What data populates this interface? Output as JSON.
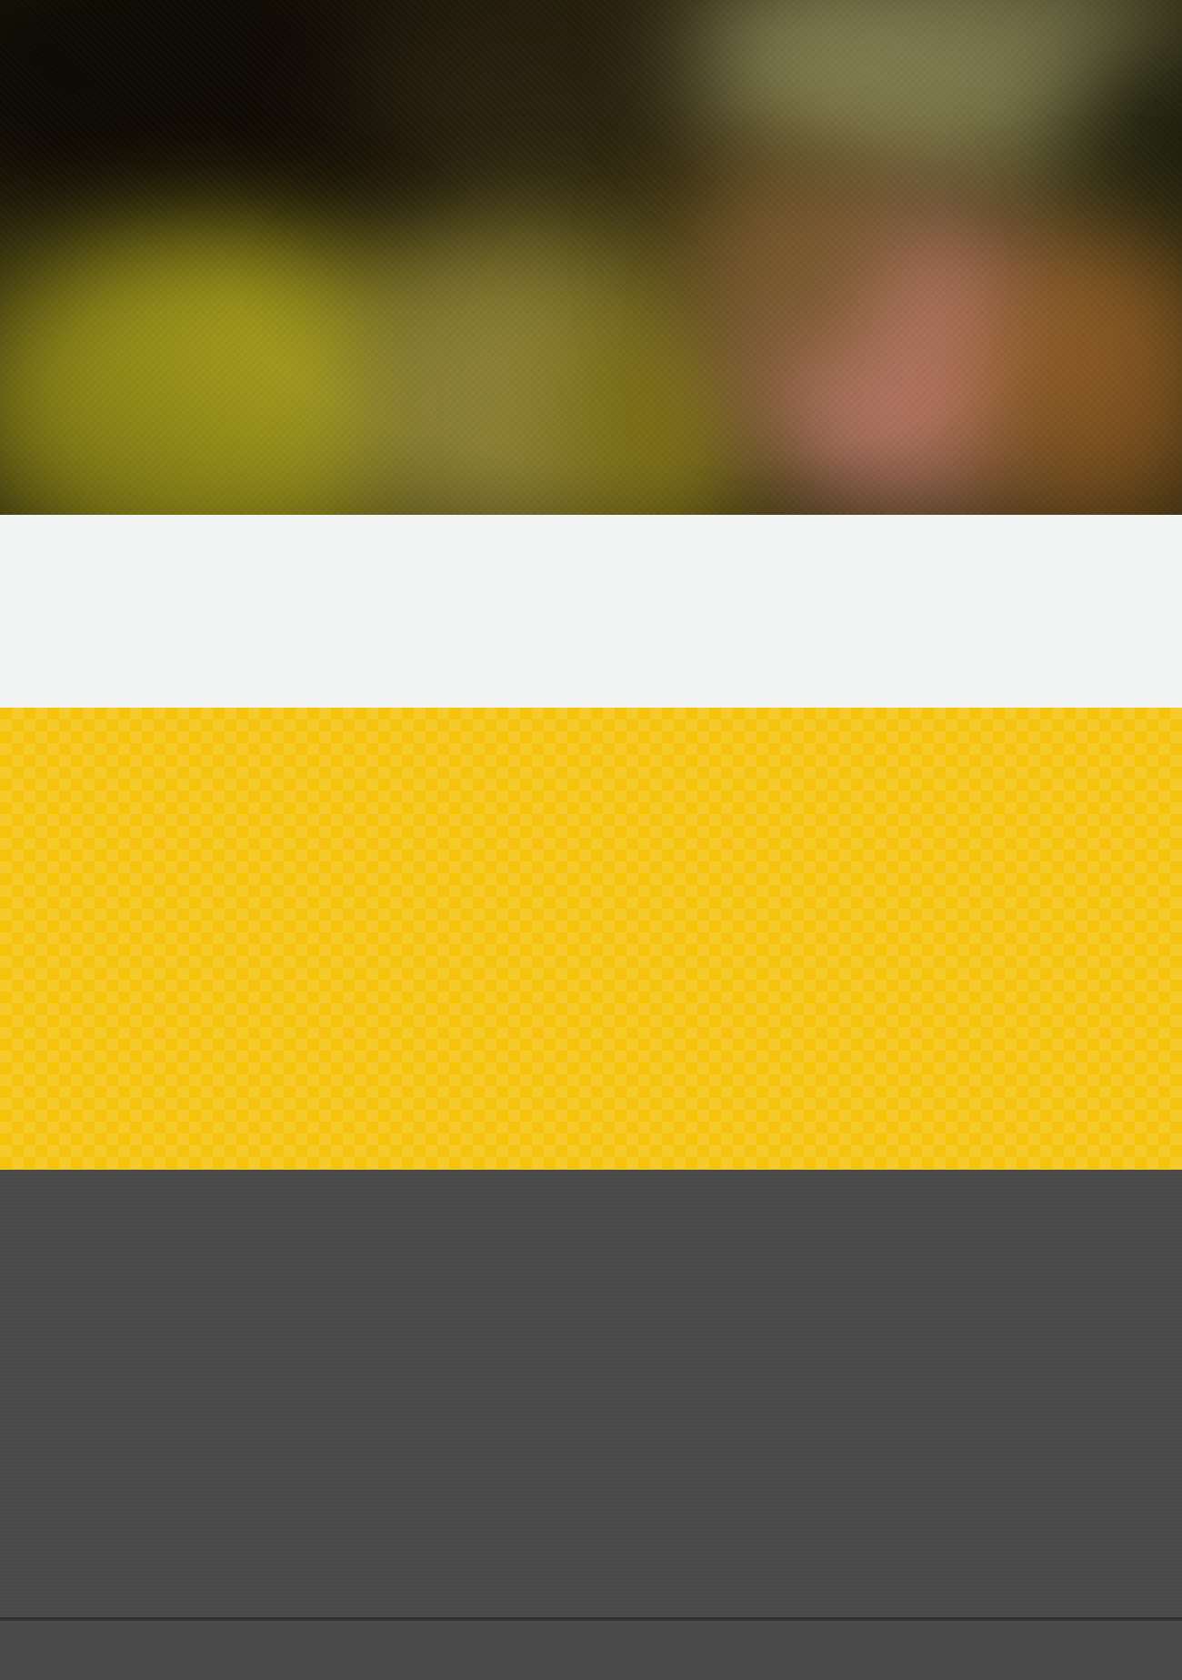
{
  "sections": {
    "hero": {
      "style": "blurred-photo"
    },
    "light_band": {
      "color": "#f3f4f4"
    },
    "yellow_band": {
      "color": "#f5c30e",
      "pattern": "checker"
    },
    "dark_band": {
      "color": "#4a4a4a"
    },
    "footer": {
      "color": "#4b4b4b"
    }
  }
}
